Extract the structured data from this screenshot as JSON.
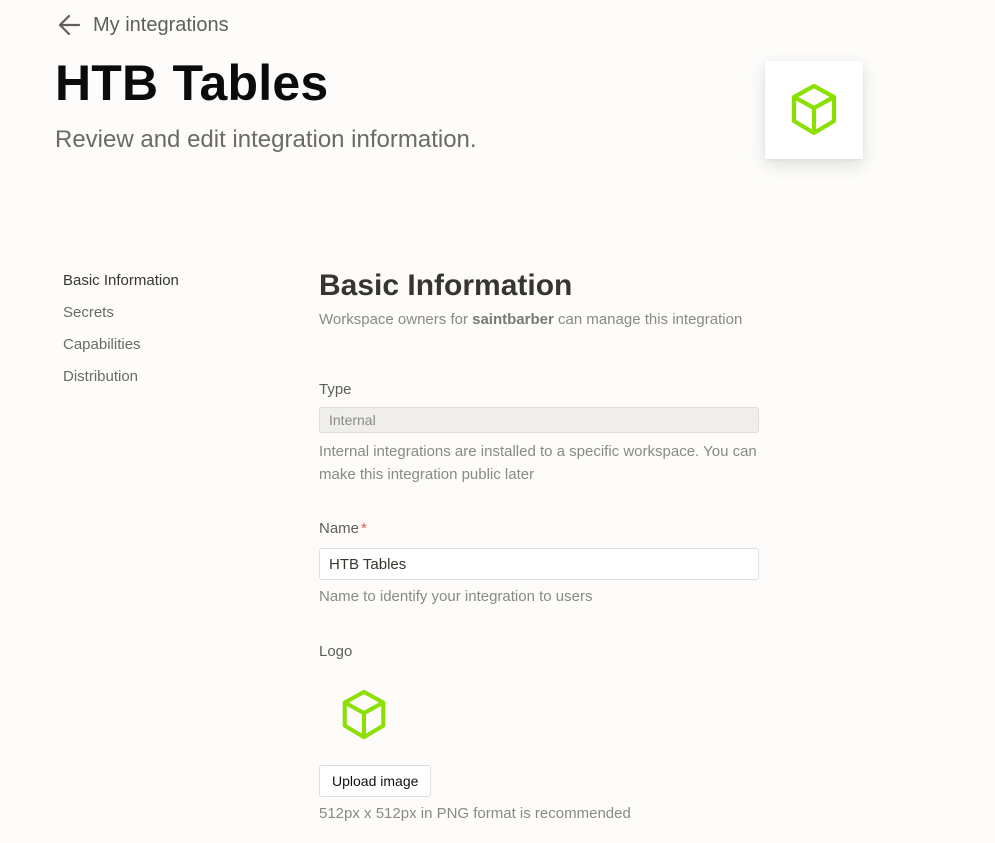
{
  "header": {
    "back_label": "My integrations",
    "title": "HTB Tables",
    "subtitle": "Review and edit integration information."
  },
  "sidebar": {
    "items": [
      {
        "label": "Basic Information",
        "active": true
      },
      {
        "label": "Secrets",
        "active": false
      },
      {
        "label": "Capabilities",
        "active": false
      },
      {
        "label": "Distribution",
        "active": false
      }
    ]
  },
  "basic_info": {
    "title": "Basic Information",
    "desc_prefix": "Workspace owners for ",
    "workspace": "saintbarber",
    "desc_suffix": " can manage this integration"
  },
  "type_field": {
    "label": "Type",
    "value": "Internal",
    "help": "Internal integrations are installed to a specific workspace. You can make this integration public later"
  },
  "name_field": {
    "label": "Name",
    "required_mark": "*",
    "value": "HTB Tables",
    "help": "Name to identify your integration to users"
  },
  "logo_field": {
    "label": "Logo",
    "upload_label": "Upload image",
    "help": "512px x 512px in PNG format is recommended",
    "icon": "cube-icon",
    "icon_color": "#8be000"
  },
  "colors": {
    "accent_green": "#8be000",
    "required_red": "#eb5757"
  }
}
